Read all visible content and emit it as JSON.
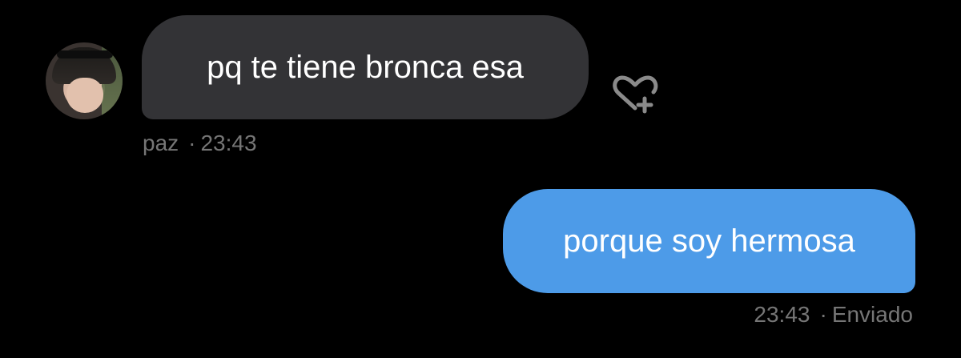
{
  "messages": {
    "received": {
      "text": "pq te tiene bronca esa",
      "sender": "paz",
      "time": "23:43",
      "avatar_icon": "avatar-photo",
      "reaction_icon": "heart-plus-icon"
    },
    "sent": {
      "text": "porque soy hermosa",
      "time": "23:43",
      "status": "Enviado"
    }
  },
  "colors": {
    "background": "#000000",
    "received_bubble": "#333336",
    "sent_bubble": "#4d9be8",
    "meta_text": "#767676"
  }
}
